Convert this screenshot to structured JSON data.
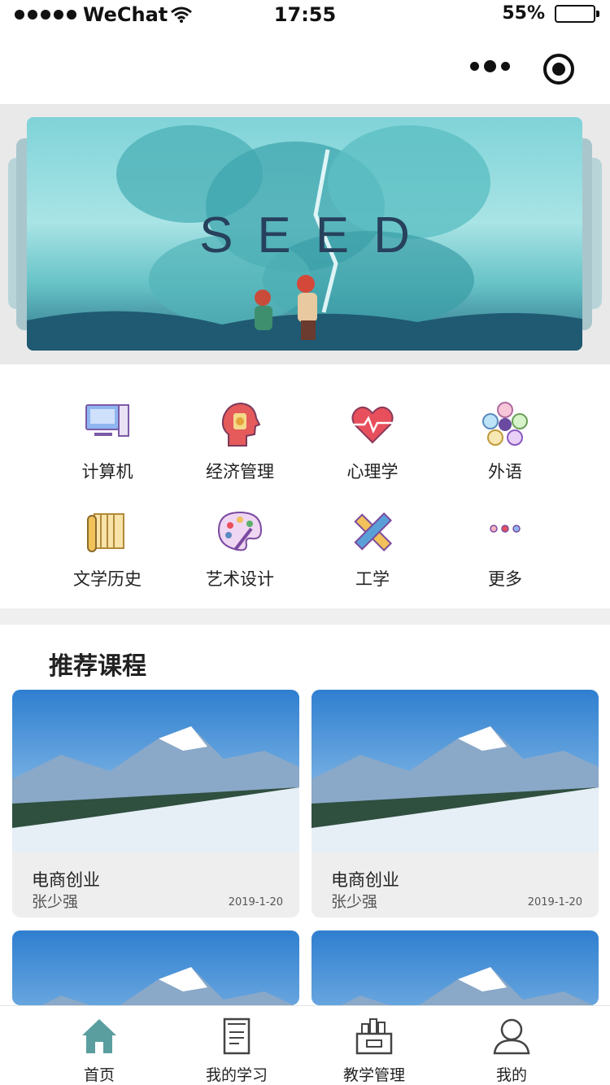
{
  "status_bar": {
    "carrier": "WeChat",
    "time": "17:55",
    "battery": "55%",
    "battery_level": 0.55
  },
  "nav": {
    "more_icon": "more-dots-icon",
    "close_icon": "capsule-close-icon"
  },
  "banner": {
    "title": "SEED"
  },
  "categories": [
    {
      "label": "计算机",
      "icon": "computer-icon"
    },
    {
      "label": "经济管理",
      "icon": "head-money-icon"
    },
    {
      "label": "心理学",
      "icon": "heart-pulse-icon"
    },
    {
      "label": "外语",
      "icon": "language-circles-icon"
    },
    {
      "label": "文学历史",
      "icon": "scroll-icon"
    },
    {
      "label": "艺术设计",
      "icon": "palette-icon"
    },
    {
      "label": "工学",
      "icon": "ruler-pencil-icon"
    },
    {
      "label": "更多",
      "icon": "more-icon"
    }
  ],
  "recommended": {
    "title": "推荐课程",
    "courses": [
      {
        "title": "电商创业",
        "author": "张少强",
        "date": "2019-1-20"
      },
      {
        "title": "电商创业",
        "author": "张少强",
        "date": "2019-1-20"
      },
      {
        "title": "",
        "author": "",
        "date": ""
      },
      {
        "title": "",
        "author": "",
        "date": ""
      }
    ]
  },
  "tabbar": [
    {
      "label": "首页",
      "icon": "home-icon",
      "active": true
    },
    {
      "label": "我的学习",
      "icon": "notebook-icon",
      "active": false
    },
    {
      "label": "教学管理",
      "icon": "management-icon",
      "active": false
    },
    {
      "label": "我的",
      "icon": "user-icon",
      "active": false
    }
  ],
  "colors": {
    "accent": "#5a9ea0",
    "banner_title": "#27415c"
  }
}
